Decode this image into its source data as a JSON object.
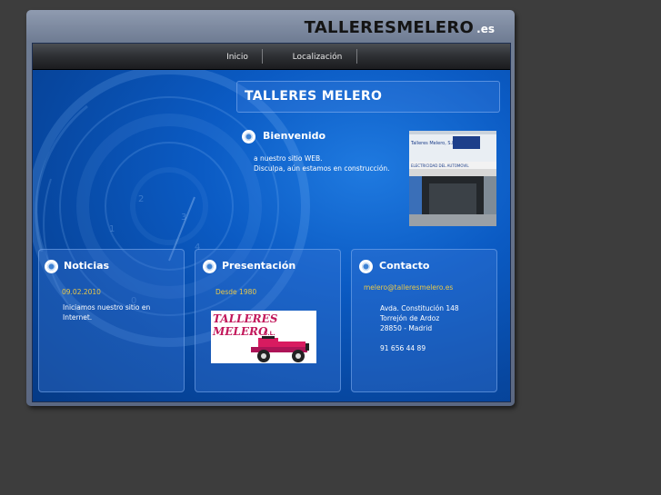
{
  "site": {
    "logo_main": "TALLERESMELERO",
    "logo_ext": ".es"
  },
  "nav": {
    "items": [
      {
        "label": "Inicio"
      },
      {
        "label": "Localización"
      }
    ]
  },
  "main": {
    "title": "TALLERES MELERO",
    "welcome_heading": "Bienvenido",
    "welcome_text": "a nuestro sitio WEB.\nDisculpa, aún estamos en construcción.",
    "photo_sign": "Talleres Melero, S.L.",
    "photo_banner": "ELECTRICIDAD DEL AUTOMOVIL"
  },
  "panels": {
    "news": {
      "heading": "Noticias",
      "date": "09.02.2010",
      "text": "Iniciamos nuestro sitio en\nInternet."
    },
    "about": {
      "heading": "Presentación",
      "since": "Desde 1980",
      "logo_line1": "TALLERES",
      "logo_line2": "MELERO",
      "logo_suffix": "S.L."
    },
    "contact": {
      "heading": "Contacto",
      "email": "melero@talleresmelero.es",
      "address": "Avda. Constitución 148\nTorrejón de Ardoz\n28850 - Madrid",
      "phone": "91 656 44 89"
    }
  },
  "colors": {
    "accent_yellow": "#e8c84a",
    "stage_blue": "#0b5bc4",
    "page_bg": "#3d3d3d"
  }
}
